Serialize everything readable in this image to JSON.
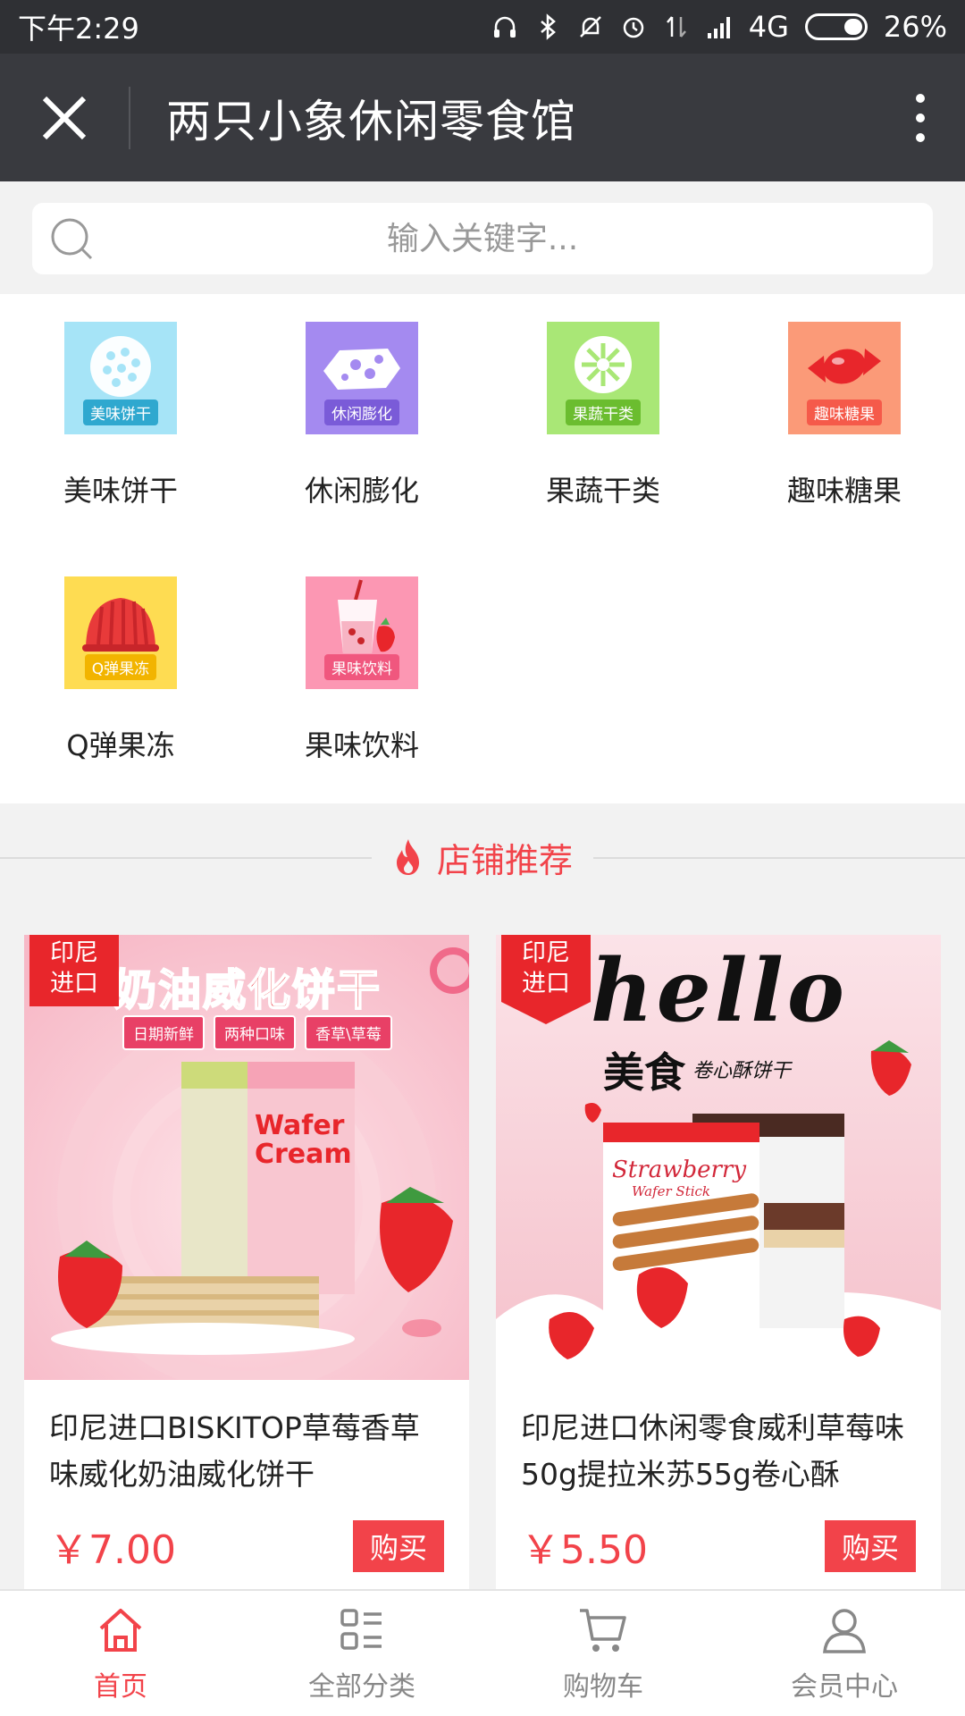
{
  "status_bar": {
    "time": "下午2:29",
    "network": "4G",
    "battery": "26%",
    "battery_level": 0.26
  },
  "nav": {
    "title": "两只小象休闲零食馆",
    "close_icon": "close-icon",
    "more_icon": "more-vertical-icon"
  },
  "search": {
    "placeholder": "输入关键字..."
  },
  "categories": [
    {
      "label": "美味饼干",
      "tag": "美味饼干",
      "color": "#a6e4f7",
      "icon": "biscuit-icon"
    },
    {
      "label": "休闲膨化",
      "tag": "休闲膨化",
      "color": "#a48af0",
      "icon": "puffed-snack-icon"
    },
    {
      "label": "果蔬干类",
      "tag": "果蔬干类",
      "color": "#a9e776",
      "icon": "dried-fruit-icon"
    },
    {
      "label": "趣味糖果",
      "tag": "趣味糖果",
      "color": "#fb9a78",
      "icon": "candy-icon"
    },
    {
      "label": "Q弹果冻",
      "tag": "Q弹果冻",
      "color": "#fedc52",
      "icon": "jelly-icon"
    },
    {
      "label": "果味饮料",
      "tag": "果味饮料",
      "color": "#fc97b3",
      "icon": "fruit-drink-icon"
    }
  ],
  "section": {
    "title": "店铺推荐",
    "icon": "fire-icon",
    "color": "#f2434a"
  },
  "products": [
    {
      "badge": "印尼进口",
      "banner": "奶油威化饼干",
      "chips": [
        "日期新鲜",
        "两种口味",
        "香草\\草莓"
      ],
      "box_text_1": "Wafer Cream",
      "name": "印尼进口BISKITOP草莓香草味威化奶油威化饼干",
      "price": "￥7.00",
      "buy_label": "购买"
    },
    {
      "badge": "印尼进口",
      "banner": "hello",
      "subbanner": "美食",
      "subbanner_small": "卷心酥饼干",
      "box_text_1": "Strawberry",
      "box_text_2": "Wafer Stick",
      "name": "印尼进口休闲零食威利草莓味50g提拉米苏55g卷心酥",
      "price": "￥5.50",
      "buy_label": "购买"
    }
  ],
  "tabs": [
    {
      "label": "首页",
      "icon": "home-icon",
      "active": true
    },
    {
      "label": "全部分类",
      "icon": "category-icon",
      "active": false
    },
    {
      "label": "购物车",
      "icon": "cart-icon",
      "active": false
    },
    {
      "label": "会员中心",
      "icon": "user-icon",
      "active": false
    }
  ],
  "colors": {
    "accent": "#f2434a",
    "nav_bg": "#393a3f",
    "status_bg": "#2f3034"
  }
}
